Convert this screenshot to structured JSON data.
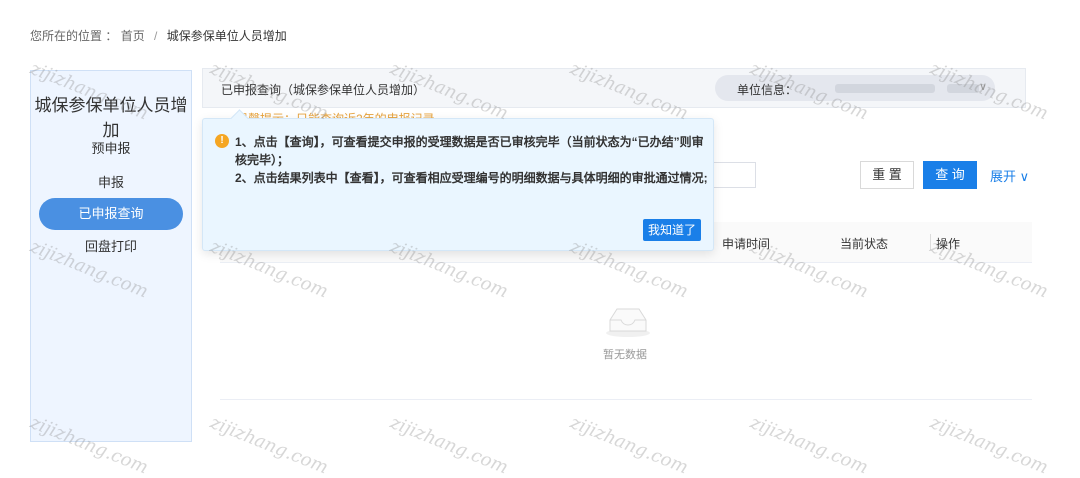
{
  "breadcrumb": {
    "prefix": "您所在的位置 ：",
    "home": "首页",
    "separator": "/",
    "current": "城保参保单位人员增加"
  },
  "sidebar": {
    "title": "城保参保单位人员增加",
    "items": [
      {
        "label": "预申报"
      },
      {
        "label": "申报"
      },
      {
        "label": "已申报查询",
        "active": true
      },
      {
        "label": "回盘打印"
      }
    ]
  },
  "panel": {
    "title": "已申报查询（城保参保单位人员增加）",
    "unit_label": "单位信息：",
    "hint_peek": "温馨提示：只能查询近2年的申报记录"
  },
  "toolbar": {
    "reset_label": "重 置",
    "query_label": "查 询",
    "expand_label": "展开 ∨"
  },
  "table": {
    "columns": [
      "申请时间",
      "当前状态",
      "操作"
    ],
    "empty_text": "暂无数据"
  },
  "tooltip": {
    "line1": "1、点击【查询】，可查看提交申报的受理数据是否已审核完毕（当前状态为“已办结”则审核完毕）；",
    "line2": "2、点击结果列表中【查看】，可查看相应受理编号的明细数据与具体明细的审批通过情况;",
    "button_label": "我知道了"
  },
  "watermark": {
    "text": "zijizhang.com"
  },
  "colors": {
    "accent": "#1a7fe8",
    "sidebar_active": "#4a90e2",
    "warning": "#f5a623",
    "tooltip_bg": "#eaf6ff"
  }
}
